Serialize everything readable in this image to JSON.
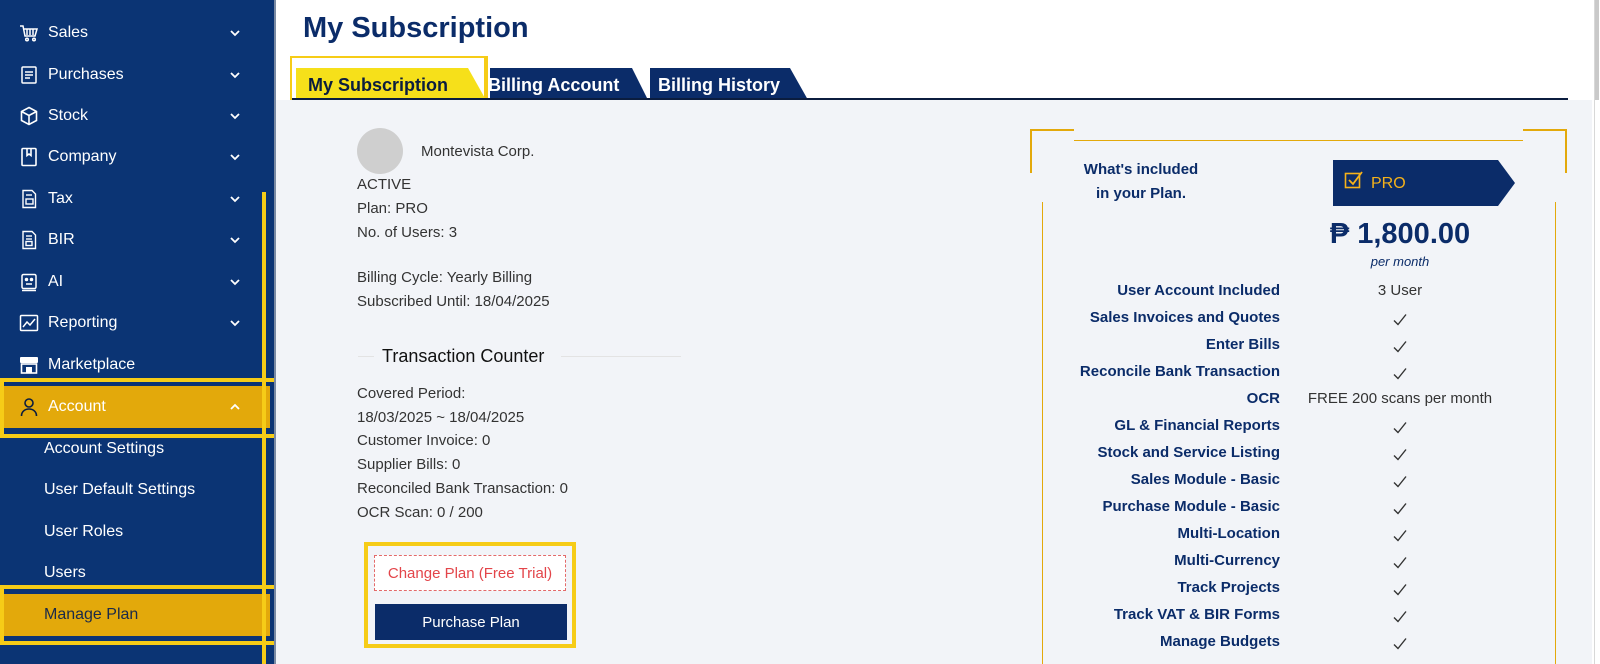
{
  "sidebar": {
    "items": [
      {
        "label": "Sales",
        "icon": "cart-icon"
      },
      {
        "label": "Purchases",
        "icon": "clipboard-icon"
      },
      {
        "label": "Stock",
        "icon": "box-icon"
      },
      {
        "label": "Company",
        "icon": "bookmark-icon"
      },
      {
        "label": "Tax",
        "icon": "document-icon"
      },
      {
        "label": "BIR",
        "icon": "document-icon"
      },
      {
        "label": "AI",
        "icon": "robot-icon"
      },
      {
        "label": "Reporting",
        "icon": "chart-icon"
      },
      {
        "label": "Marketplace",
        "icon": "store-icon"
      },
      {
        "label": "Account",
        "icon": "user-icon"
      }
    ],
    "sub_items": [
      {
        "label": "Account Settings"
      },
      {
        "label": "User Default Settings"
      },
      {
        "label": "User Roles"
      },
      {
        "label": "Users"
      },
      {
        "label": "Manage Plan"
      }
    ]
  },
  "header": {
    "title": "My Subscription"
  },
  "tabs": [
    {
      "label": "My Subscription"
    },
    {
      "label": "Billing Account"
    },
    {
      "label": "Billing History"
    }
  ],
  "subscription": {
    "company": "Montevista Corp.",
    "status": "ACTIVE",
    "plan": "Plan: PRO",
    "users": "No. of Users: 3",
    "billing_cycle": "Billing Cycle: Yearly Billing",
    "subscribed_until": "Subscribed Until: 18/04/2025"
  },
  "counter": {
    "title": "Transaction Counter",
    "covered_label": "Covered Period:",
    "covered_range": "18/03/2025 ~ 18/04/2025",
    "customer_invoice": "Customer Invoice: 0",
    "supplier_bills": "Supplier Bills: 0",
    "reconciled": "Reconciled Bank Transaction: 0",
    "ocr_scan": "OCR Scan: 0 / 200"
  },
  "buttons": {
    "change_plan": "Change Plan (Free Trial)",
    "purchase_plan": "Purchase Plan"
  },
  "plan": {
    "included_line1": "What's included",
    "included_line2": "in your Plan.",
    "badge": "PRO",
    "price": "₱ 1,800.00",
    "per": "per month",
    "features": [
      {
        "name": "User Account Included",
        "value": "3 User"
      },
      {
        "name": "Sales Invoices and Quotes",
        "value": "check"
      },
      {
        "name": "Enter Bills",
        "value": "check"
      },
      {
        "name": "Reconcile Bank Transaction",
        "value": "check"
      },
      {
        "name": "OCR",
        "value": "FREE 200 scans per month"
      },
      {
        "name": "GL & Financial Reports",
        "value": "check"
      },
      {
        "name": "Stock and Service Listing",
        "value": "check"
      },
      {
        "name": "Sales Module - Basic",
        "value": "check"
      },
      {
        "name": "Purchase Module - Basic",
        "value": "check"
      },
      {
        "name": "Multi-Location",
        "value": "check"
      },
      {
        "name": "Multi-Currency",
        "value": "check"
      },
      {
        "name": "Track Projects",
        "value": "check"
      },
      {
        "name": "Track VAT & BIR Forms",
        "value": "check"
      },
      {
        "name": "Manage Budgets",
        "value": "check"
      }
    ]
  },
  "colors": {
    "sidebar_bg": "#0b3474",
    "accent_gold": "#e3a90b",
    "highlight_yellow": "#f6cc17",
    "navy": "#0b2c69",
    "danger": "#e3454a"
  }
}
